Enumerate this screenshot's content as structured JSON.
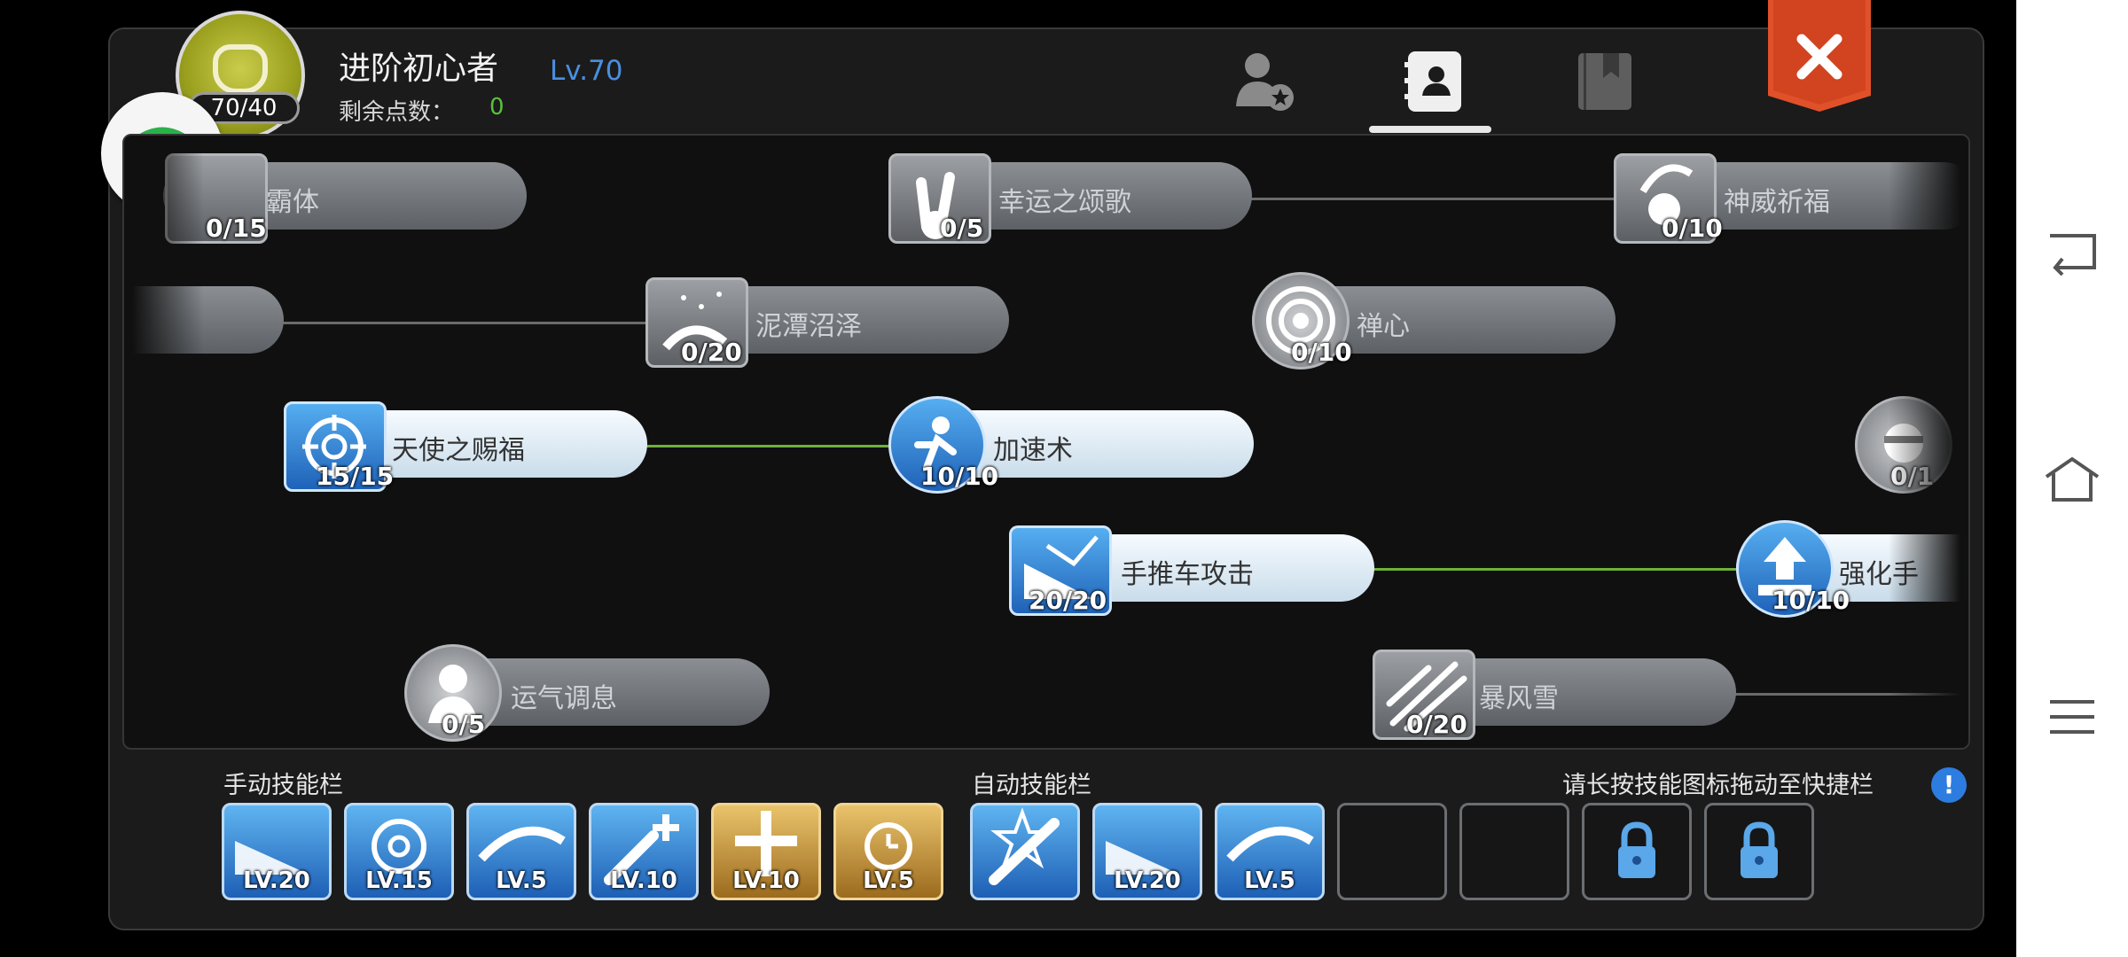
{
  "header": {
    "title": "进阶初心者",
    "level": "Lv.70",
    "points_badge": "70/40",
    "remaining_label": "剩余点数：",
    "remaining_value": "0"
  },
  "tabs": [
    {
      "name": "character-tab",
      "icon": "person-star-icon"
    },
    {
      "name": "skill-tab",
      "icon": "contact-book-icon",
      "active": true
    },
    {
      "name": "book-tab",
      "icon": "bookmark-book-icon"
    }
  ],
  "skills": [
    {
      "name": "霸体",
      "level": "0/15",
      "learned": false
    },
    {
      "name": "幸运之颂歌",
      "level": "0/5",
      "learned": false
    },
    {
      "name": "神威祈福",
      "level": "0/10",
      "learned": false
    },
    {
      "name": "泥潭沼泽",
      "level": "0/20",
      "learned": false
    },
    {
      "name": "禅心",
      "level": "0/10",
      "learned": false
    },
    {
      "name": "天使之赐福",
      "level": "15/15",
      "learned": true
    },
    {
      "name": "加速术",
      "level": "10/10",
      "learned": true
    },
    {
      "name": "",
      "level": "0/1",
      "learned": false
    },
    {
      "name": "手推车攻击",
      "level": "20/20",
      "learned": true
    },
    {
      "name": "强化手",
      "level": "10/10",
      "learned": true
    },
    {
      "name": "运气调息",
      "level": "0/5",
      "learned": false
    },
    {
      "name": "暴风雪",
      "level": "0/20",
      "learned": false
    }
  ],
  "manual_bar": {
    "label": "手动技能栏",
    "slots": [
      "LV.20",
      "LV.15",
      "LV.5",
      "LV.10",
      "LV.10",
      "LV.5"
    ]
  },
  "auto_bar": {
    "label": "自动技能栏",
    "slots": [
      "",
      "LV.20",
      "LV.5"
    ]
  },
  "hint": "请长按技能图标拖动至快捷栏",
  "info_icon": "!",
  "colors": {
    "level": "#4a8fe0",
    "remaining": "#57c33a",
    "learned_line": "#6fb13a",
    "close": "#e0512a"
  }
}
